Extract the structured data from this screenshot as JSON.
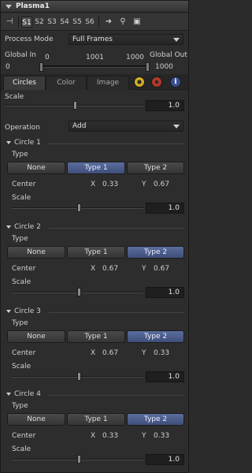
{
  "tool": {
    "title": "Plasma1"
  },
  "toolbar": {
    "slots": [
      "S1",
      "S2",
      "S3",
      "S4",
      "S5",
      "S6"
    ],
    "active_slot": "S1"
  },
  "process_mode": {
    "label": "Process Mode",
    "value": "Full Frames"
  },
  "global": {
    "in_label": "Global In",
    "out_label": "Global Out",
    "in_value": "0",
    "out_value": "1000",
    "range_start": "0",
    "range_mid": "1001",
    "range_end": "1000"
  },
  "tabs": [
    {
      "label": "Circles",
      "active": true
    },
    {
      "label": "Color",
      "active": false
    },
    {
      "label": "Image",
      "active": false
    }
  ],
  "scale": {
    "label": "Scale",
    "value": "1.0"
  },
  "operation": {
    "label": "Operation",
    "value": "Add"
  },
  "circles": [
    {
      "title": "Circle 1",
      "type_label": "Type",
      "types": [
        "None",
        "Type 1",
        "Type 2"
      ],
      "selected": "Type 1",
      "center_label": "Center",
      "x_label": "X",
      "x": "0.33",
      "y_label": "Y",
      "y": "0.67",
      "scale_label": "Scale",
      "scale": "1.0"
    },
    {
      "title": "Circle 2",
      "type_label": "Type",
      "types": [
        "None",
        "Type 1",
        "Type 2"
      ],
      "selected": "Type 2",
      "center_label": "Center",
      "x_label": "X",
      "x": "0.67",
      "y_label": "Y",
      "y": "0.67",
      "scale_label": "Scale",
      "scale": "1.0"
    },
    {
      "title": "Circle 3",
      "type_label": "Type",
      "types": [
        "None",
        "Type 1",
        "Type 2"
      ],
      "selected": "Type 2",
      "center_label": "Center",
      "x_label": "X",
      "x": "0.67",
      "y_label": "Y",
      "y": "0.33",
      "scale_label": "Scale",
      "scale": "1.0"
    },
    {
      "title": "Circle 4",
      "type_label": "Type",
      "types": [
        "None",
        "Type 1",
        "Type 2"
      ],
      "selected": "Type 2",
      "center_label": "Center",
      "x_label": "X",
      "x": "0.33",
      "y_label": "Y",
      "y": "0.33",
      "scale_label": "Scale",
      "scale": "1.0"
    }
  ],
  "colors": {
    "accent": "#4f5f8e",
    "panel": "#2d2d2d"
  }
}
